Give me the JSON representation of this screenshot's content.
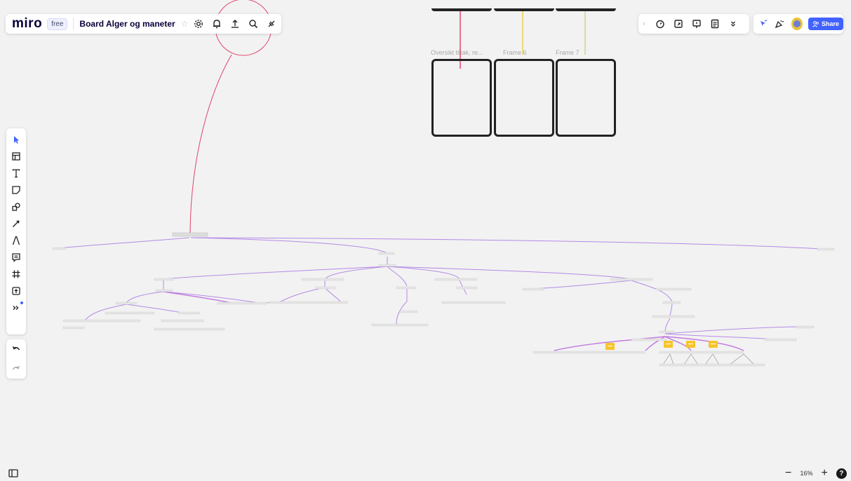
{
  "app": {
    "logo": "miro",
    "plan_badge": "free",
    "board_name": "Board Alger og maneter",
    "share_label": "Share",
    "zoom_level": "16%",
    "zoom_minus": "−",
    "zoom_plus": "+",
    "help_label": "?"
  },
  "frames": [
    {
      "label": "Oversikt tiltak, re..."
    },
    {
      "label": "Frame 6"
    },
    {
      "label": "Frame 7"
    }
  ],
  "toolbar_left": [
    {
      "icon": "select-cursor-icon"
    },
    {
      "icon": "templates-icon"
    },
    {
      "icon": "text-icon"
    },
    {
      "icon": "sticky-note-icon"
    },
    {
      "icon": "shapes-icon"
    },
    {
      "icon": "connection-line-icon"
    },
    {
      "icon": "pen-icon"
    },
    {
      "icon": "comment-icon"
    },
    {
      "icon": "frame-icon"
    },
    {
      "icon": "upload-icon"
    },
    {
      "icon": "more-tools-icon"
    }
  ],
  "colors": {
    "accent": "#4262ff",
    "canvas": "#f2f2f2",
    "sticky": "#f7c52a",
    "connector_pink": "#e0446a",
    "connector_purple": "#b48ae6",
    "connector_yellow": "#e6c300"
  }
}
